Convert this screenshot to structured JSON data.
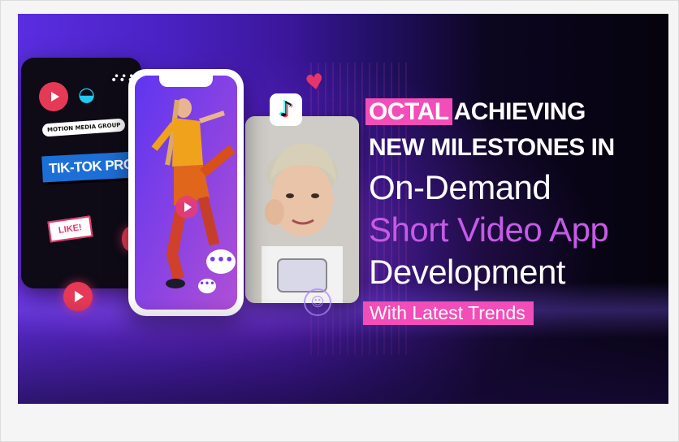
{
  "banner": {
    "headline": {
      "brand": "OCTAL",
      "line1_rest": "ACHIEVING",
      "line2": "NEW MILESTONES IN",
      "line3": "On-Demand",
      "line4": "Short Video App",
      "line5": "Development",
      "tagline": "With Latest Trends"
    },
    "card": {
      "tag_media_group": "MOTION MEDIA GROUP",
      "tag_promo": "TIK-TOK PROM",
      "tag_like": "LIKE!"
    },
    "colors": {
      "accent_pink": "#f24db8",
      "accent_purple": "#c55be6",
      "background_left": "#5a2ee0",
      "background_right": "#05030d"
    },
    "icons": [
      "play-icon",
      "eye-icon",
      "heart-icon",
      "tiktok-logo-icon",
      "chat-bubble-icon",
      "smiley-icon"
    ]
  }
}
